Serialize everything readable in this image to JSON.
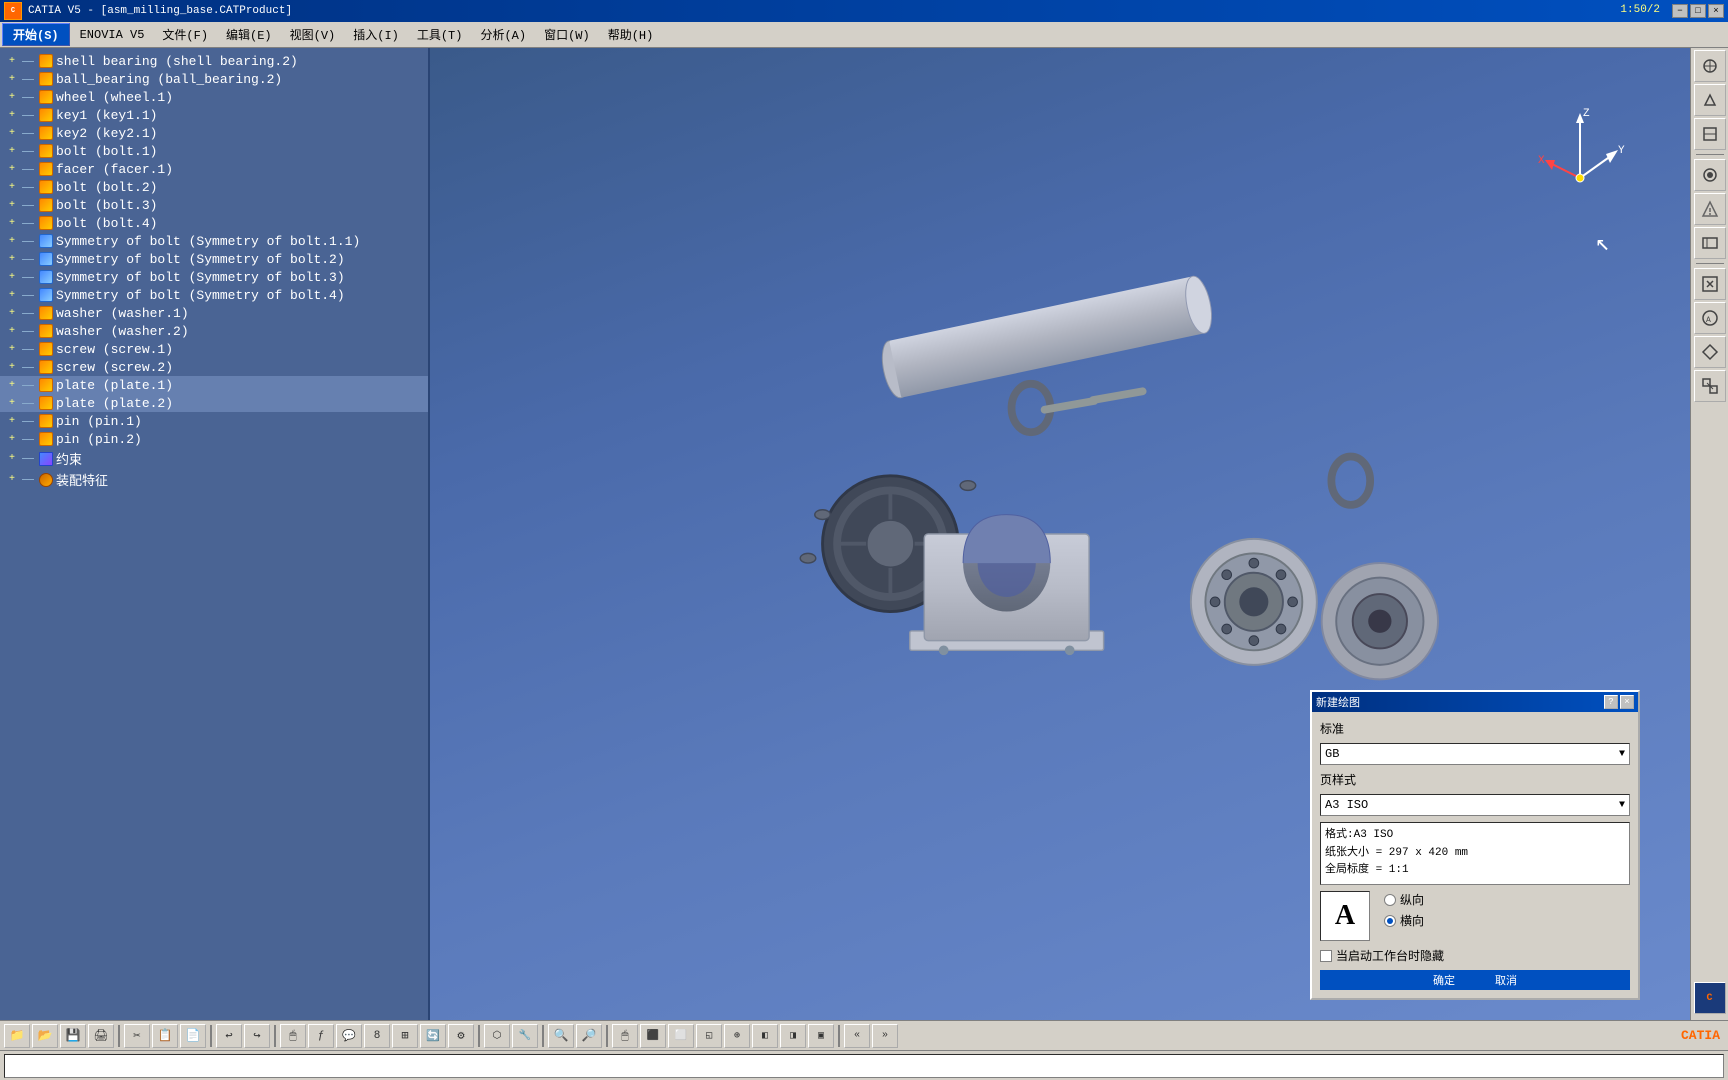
{
  "titlebar": {
    "title": "CATIA V5 - [asm_milling_base.CATProduct]",
    "logo": "CATIA",
    "time": "1:50/2",
    "close": "×",
    "minimize": "−",
    "maximize": "□"
  },
  "menubar": {
    "start": "开始(S)",
    "items": [
      {
        "label": "ENOVIA V5"
      },
      {
        "label": "文件(F)"
      },
      {
        "label": "编辑(E)"
      },
      {
        "label": "视图(V)"
      },
      {
        "label": "插入(I)"
      },
      {
        "label": "工具(T)"
      },
      {
        "label": "分析(A)"
      },
      {
        "label": "窗口(W)"
      },
      {
        "label": "帮助(H)"
      }
    ]
  },
  "tree": {
    "items": [
      {
        "id": 1,
        "label": "shell bearing (shell bearing.2)",
        "level": 1,
        "icon": "part",
        "selected": false
      },
      {
        "id": 2,
        "label": "ball_bearing (ball_bearing.2)",
        "level": 1,
        "icon": "part",
        "selected": false
      },
      {
        "id": 3,
        "label": "wheel (wheel.1)",
        "level": 1,
        "icon": "part",
        "selected": false
      },
      {
        "id": 4,
        "label": "key1 (key1.1)",
        "level": 1,
        "icon": "part",
        "selected": false
      },
      {
        "id": 5,
        "label": "key2 (key2.1)",
        "level": 1,
        "icon": "part",
        "selected": false
      },
      {
        "id": 6,
        "label": "bolt (bolt.1)",
        "level": 1,
        "icon": "part",
        "selected": false
      },
      {
        "id": 7,
        "label": "facer (facer.1)",
        "level": 1,
        "icon": "part",
        "selected": false
      },
      {
        "id": 8,
        "label": "bolt (bolt.2)",
        "level": 1,
        "icon": "part",
        "selected": false
      },
      {
        "id": 9,
        "label": "bolt (bolt.3)",
        "level": 1,
        "icon": "part",
        "selected": false
      },
      {
        "id": 10,
        "label": "bolt (bolt.4)",
        "level": 1,
        "icon": "part",
        "selected": false
      },
      {
        "id": 11,
        "label": "Symmetry of bolt (Symmetry of bolt.1.1)",
        "level": 1,
        "icon": "sym",
        "selected": false
      },
      {
        "id": 12,
        "label": "Symmetry of bolt (Symmetry of bolt.2)",
        "level": 1,
        "icon": "sym",
        "selected": false
      },
      {
        "id": 13,
        "label": "Symmetry of bolt (Symmetry of bolt.3)",
        "level": 1,
        "icon": "sym",
        "selected": false
      },
      {
        "id": 14,
        "label": "Symmetry of bolt (Symmetry of bolt.4)",
        "level": 1,
        "icon": "sym",
        "selected": false
      },
      {
        "id": 15,
        "label": "washer (washer.1)",
        "level": 1,
        "icon": "part",
        "selected": false
      },
      {
        "id": 16,
        "label": "washer (washer.2)",
        "level": 1,
        "icon": "part",
        "selected": false
      },
      {
        "id": 17,
        "label": "screw (screw.1)",
        "level": 1,
        "icon": "part",
        "selected": false
      },
      {
        "id": 18,
        "label": "screw (screw.2)",
        "level": 1,
        "icon": "part",
        "selected": false
      },
      {
        "id": 19,
        "label": "plate (plate.1)",
        "level": 1,
        "icon": "part",
        "selected": true
      },
      {
        "id": 20,
        "label": "plate (plate.2)",
        "level": 1,
        "icon": "part",
        "selected": true
      },
      {
        "id": 21,
        "label": "pin (pin.1)",
        "level": 1,
        "icon": "part",
        "selected": false
      },
      {
        "id": 22,
        "label": "pin (pin.2)",
        "level": 1,
        "icon": "part",
        "selected": false
      },
      {
        "id": 23,
        "label": "约束",
        "level": 1,
        "icon": "constraint",
        "selected": false
      },
      {
        "id": 24,
        "label": "装配特征",
        "level": 1,
        "icon": "gear",
        "selected": false
      }
    ]
  },
  "dialog": {
    "title": "新建绘图",
    "standard_label": "标准",
    "standard_value": "GB",
    "page_style_label": "页样式",
    "page_style_value": "A3 ISO",
    "info_line1": "格式:A3 ISO",
    "info_line2": "纸张大小 = 297 x 420 mm",
    "info_line3": "全局标度 = 1:1",
    "preview_letter": "A",
    "portrait_label": "纵向",
    "landscape_label": "横向",
    "checkbox_label": "当启动工作台时隐藏",
    "ok_label": "确定",
    "cancel_label": "取消"
  },
  "bottom_toolbar": {
    "buttons": [
      "📁",
      "📂",
      "💾",
      "🖨",
      "✂",
      "📋",
      "📄",
      "↩",
      "↪",
      "🖱",
      "ƒ",
      "💬",
      "🔢",
      "⊞",
      "🔄",
      "⚙",
      "🔧",
      "◫",
      "➤",
      "✦",
      "🔄",
      "⬡",
      "⬢",
      "🔍",
      "🔎",
      "🔎",
      "🖱",
      "⬛",
      "⬜",
      "◱",
      "⊕",
      "⬛",
      "⬜",
      "▣"
    ]
  },
  "right_toolbar": {
    "buttons": [
      "⚙",
      "⚙",
      "⚙",
      "⚙",
      "⚙",
      "⚙",
      "⚙",
      "⚙",
      "⚙",
      "⚙",
      "⚙",
      "⚙"
    ]
  },
  "status": {
    "text": ""
  }
}
